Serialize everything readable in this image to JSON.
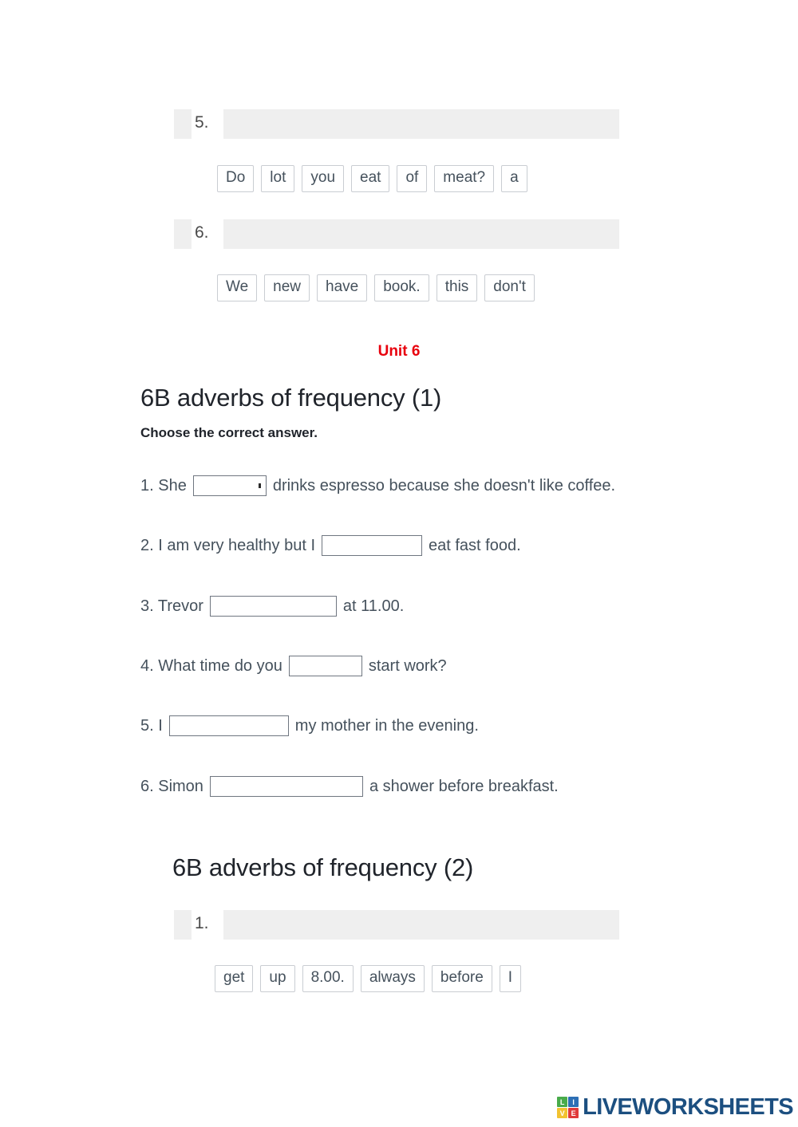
{
  "worksheet": {
    "unit_label": "Unit 6",
    "footer_logo": {
      "word": "LIVEWORKSHEETS",
      "cells": [
        {
          "letter": "L",
          "color": "#49ab4b"
        },
        {
          "letter": "I",
          "color": "#2d6fb5"
        },
        {
          "letter": "V",
          "color": "#f2c230"
        },
        {
          "letter": "E",
          "color": "#e03a3a"
        }
      ]
    },
    "order_exercise_top": {
      "items": [
        {
          "number": "5.",
          "chips": [
            "Do",
            "lot",
            "you",
            "eat",
            "of",
            "meat?",
            "a"
          ]
        },
        {
          "number": "6.",
          "chips": [
            "We",
            "new",
            "have",
            "book.",
            "this",
            "don't"
          ]
        }
      ]
    },
    "section_one": {
      "title": "6B adverbs of frequency (1)",
      "instruction": "Choose the correct answer.",
      "questions": [
        {
          "number": "1.",
          "pre": "1. She",
          "post": "drinks espresso because she doesn't like coffee.",
          "field_value": "",
          "field_type": "select",
          "field_width": 92
        },
        {
          "number": "2.",
          "pre": "2. I am very healthy but I",
          "post": "eat fast food.",
          "field_value": "",
          "field_type": "text",
          "field_width": 126
        },
        {
          "number": "3.",
          "pre": "3. Trevor",
          "post": "at 11.00.",
          "field_value": "",
          "field_type": "text",
          "field_width": 159
        },
        {
          "number": "4.",
          "pre": "4. What time do you",
          "post": "start work?",
          "field_value": "",
          "field_type": "text",
          "field_width": 92
        },
        {
          "number": "5.",
          "pre": "5. I",
          "post": "my mother in the evening.",
          "field_value": "",
          "field_type": "text",
          "field_width": 150
        },
        {
          "number": "6.",
          "pre": "6. Simon",
          "post": "a shower before breakfast.",
          "field_value": "",
          "field_type": "text",
          "field_width": 192
        }
      ]
    },
    "section_two": {
      "title": "6B adverbs of frequency (2)",
      "items": [
        {
          "number": "1.",
          "chips": [
            "get",
            "up",
            "8.00.",
            "always",
            "before",
            "I"
          ]
        }
      ]
    }
  }
}
